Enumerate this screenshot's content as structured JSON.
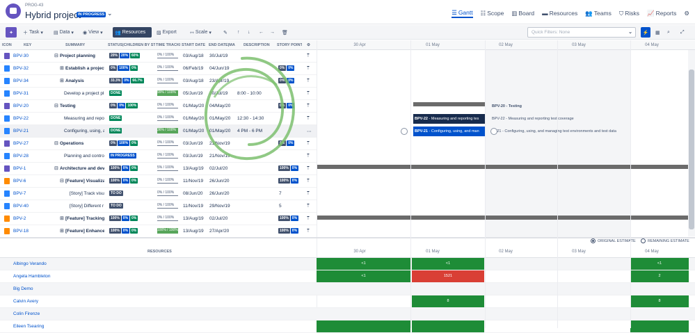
{
  "header": {
    "project_id": "PROG-43",
    "title": "Hybrid project",
    "status": "IN PROGRESS",
    "views": [
      {
        "label": "Gantt",
        "icon": "gantt-icon",
        "active": true
      },
      {
        "label": "Scope",
        "icon": "scope-icon"
      },
      {
        "label": "Board",
        "icon": "board-icon"
      },
      {
        "label": "Resources",
        "icon": "resources-icon"
      },
      {
        "label": "Teams",
        "icon": "teams-icon"
      },
      {
        "label": "Risks",
        "icon": "risks-icon"
      },
      {
        "label": "Reports",
        "icon": "reports-icon"
      }
    ]
  },
  "toolbar": {
    "task": "Task",
    "data": "Data",
    "view": "View",
    "resources": "Resources",
    "export": "Export",
    "scale": "Scale",
    "quick_filters": "Quick Filters: None"
  },
  "columns": {
    "icon": "ICON",
    "key": "KEY",
    "summary": "SUMMARY",
    "status": "STATUS|CHILDREN BY STATUS",
    "time": "TIME TRACKING",
    "start": "START DATE",
    "end": "END DATE|MANUAL",
    "desc": "DESCRIPTION",
    "sp": "STORY POINTS"
  },
  "timeline": {
    "dates": [
      "30 Apr",
      "01 May",
      "02 May",
      "03 May",
      "04 May"
    ]
  },
  "rows": [
    {
      "key": "BPV-30",
      "icon": "epic",
      "summary": "Project planning",
      "bold": true,
      "exp": "⊟",
      "ind": 0,
      "badges": [
        "20%",
        "20%",
        "60%"
      ],
      "bc": [
        "gr",
        "bl",
        "g"
      ],
      "time": "0% / 100%",
      "tg": false,
      "start": "03/Aug/18",
      "end": "30/Jul/19",
      "desc": "",
      "sp": ""
    },
    {
      "key": "BPV-32",
      "icon": "story",
      "summary": "Establish a project s",
      "bold": true,
      "exp": "⊞",
      "ind": 1,
      "badges": [
        "0%",
        "100%",
        "0%"
      ],
      "bc": [
        "gr",
        "bl",
        "g"
      ],
      "time": "0% / 100%",
      "tg": false,
      "start": "06/Feb/19",
      "end": "04/Jun/19",
      "desc": "",
      "sp": "0%|0%"
    },
    {
      "key": "BPV-34",
      "icon": "story",
      "summary": "Analysis",
      "bold": true,
      "exp": "⊞",
      "ind": 1,
      "badges": [
        "33.3%",
        "0%",
        "66.7%"
      ],
      "bc": [
        "gr",
        "bl",
        "g"
      ],
      "time": "0% / 100%",
      "tg": false,
      "start": "03/Aug/18",
      "end": "23/Apr/19",
      "desc": "",
      "sp": "0%|0%"
    },
    {
      "key": "BPV-31",
      "icon": "story",
      "summary": "Develop a project pl",
      "bold": false,
      "exp": "",
      "ind": 1,
      "badges": [
        "DONE"
      ],
      "bc": [
        "g"
      ],
      "time": "99% / 100%",
      "tg": true,
      "start": "05/Jun/19",
      "end": "30/Jul/19",
      "desc": "8:00 - 10:00",
      "sp": ""
    },
    {
      "key": "BPV-20",
      "icon": "epic",
      "summary": "Testing",
      "bold": true,
      "exp": "⊟",
      "ind": 0,
      "badges": [
        "0%",
        "0%",
        "100%"
      ],
      "bc": [
        "gr",
        "bl",
        "g"
      ],
      "time": "0% / 100%",
      "tg": false,
      "start": "01/May/20",
      "end": "04/May/20",
      "desc": "",
      "sp": "0%|0%"
    },
    {
      "key": "BPV-22",
      "icon": "story",
      "summary": "Measuring and repo",
      "bold": false,
      "exp": "",
      "ind": 1,
      "badges": [
        "DONE"
      ],
      "bc": [
        "g"
      ],
      "time": "0% / 100%",
      "tg": false,
      "start": "01/May/20",
      "end": "01/May/20",
      "desc": "12:30 - 14:30",
      "sp": ""
    },
    {
      "key": "BPV-21",
      "icon": "story",
      "summary": "Configuring, using, a",
      "bold": false,
      "exp": "",
      "ind": 1,
      "badges": [
        "DONE"
      ],
      "bc": [
        "g"
      ],
      "time": "36% / 100%",
      "tg": true,
      "start": "01/May/20",
      "end": "01/May/20",
      "desc": "4 PM - 6 PM",
      "sp": "",
      "sel": true
    },
    {
      "key": "BPV-27",
      "icon": "epic",
      "summary": "Operations",
      "bold": true,
      "exp": "⊟",
      "ind": 0,
      "badges": [
        "0%",
        "100%",
        "0%"
      ],
      "bc": [
        "gr",
        "bl",
        "g"
      ],
      "time": "0% / 100%",
      "tg": false,
      "start": "03/Jun/19",
      "end": "21/Nov/19",
      "desc": "",
      "sp": "0%|0%"
    },
    {
      "key": "BPV-28",
      "icon": "story",
      "summary": "Planning and contro",
      "bold": false,
      "exp": "",
      "ind": 1,
      "badges": [
        "IN PROGRESS"
      ],
      "bc": [
        "bl"
      ],
      "time": "0% / 100%",
      "tg": false,
      "start": "03/Jun/19",
      "end": "21/Nov/19",
      "desc": "",
      "sp": ""
    },
    {
      "key": "BPV-1",
      "icon": "epic",
      "summary": "Architecture and deve",
      "bold": true,
      "exp": "⊟",
      "ind": 0,
      "badges": [
        "100%",
        "0%",
        "0%"
      ],
      "bc": [
        "gr",
        "bl",
        "g"
      ],
      "time": "5% / 100%",
      "tg": false,
      "start": "13/Aug/19",
      "end": "02/Jul/20",
      "desc": "",
      "sp": "100%|0%"
    },
    {
      "key": "BPV-6",
      "icon": "feature",
      "summary": "[Feature] Visualizat",
      "bold": true,
      "exp": "⊟",
      "ind": 1,
      "badges": [
        "100%",
        "0%",
        "0%"
      ],
      "bc": [
        "gr",
        "bl",
        "g"
      ],
      "time": "0% / 100%",
      "tg": false,
      "start": "11/Nov/19",
      "end": "26/Jun/20",
      "desc": "",
      "sp": "100%|0%"
    },
    {
      "key": "BPV-7",
      "icon": "story",
      "summary": "[Story] Track visu",
      "bold": false,
      "exp": "",
      "ind": 2,
      "badges": [
        "TO DO"
      ],
      "bc": [
        "gr"
      ],
      "time": "0% / 100%",
      "tg": false,
      "start": "08/Jun/20",
      "end": "26/Jun/20",
      "desc": "",
      "sp": "7"
    },
    {
      "key": "BPV-40",
      "icon": "story",
      "summary": "[Story] Different r",
      "bold": false,
      "exp": "",
      "ind": 2,
      "badges": [
        "TO DO"
      ],
      "bc": [
        "gr"
      ],
      "time": "0% / 100%",
      "tg": false,
      "start": "11/Nov/19",
      "end": "29/Nov/19",
      "desc": "",
      "sp": "5"
    },
    {
      "key": "BPV-2",
      "icon": "feature",
      "summary": "[Feature] Tracking a",
      "bold": true,
      "exp": "⊞",
      "ind": 1,
      "badges": [
        "100%",
        "0%",
        "0%"
      ],
      "bc": [
        "gr",
        "bl",
        "g"
      ],
      "time": "0% / 100%",
      "tg": false,
      "start": "13/Aug/19",
      "end": "02/Jul/20",
      "desc": "",
      "sp": "100%|0%"
    },
    {
      "key": "BPV-18",
      "icon": "feature",
      "summary": "[Feature] Enhanced",
      "bold": true,
      "exp": "⊞",
      "ind": 1,
      "badges": [
        "100%",
        "0%",
        "0%"
      ],
      "bc": [
        "gr",
        "bl",
        "g"
      ],
      "time": "100% / 100%",
      "tg": true,
      "start": "13/Aug/19",
      "end": "27/Apr/20",
      "desc": "",
      "sp": "100%|0%"
    }
  ],
  "gantt": {
    "testing_label": "BPV-20 - Testing",
    "bpv22_key": "BPV-22",
    "bpv22_text": " - Measuring and reporting tes",
    "bpv22_label": "BPV-22 - Measuring and reporting test coverage",
    "bpv21_key": "BPV-21",
    "bpv21_text": " - Configuring, using, and man",
    "bpv21_label": "/-21 - Configuring, using, and managing test environments and test data"
  },
  "estimates": {
    "original": "ORIGINAL ESTIMATE",
    "remaining": "REMAINING ESTIMATE"
  },
  "resources": {
    "header": "RESOURCES",
    "people": [
      {
        "name": "Albingo Verando",
        "cells": [
          {
            "c": 0,
            "v": "<1",
            "t": "gn"
          },
          {
            "c": 1,
            "v": "<1",
            "t": "gn"
          },
          {
            "c": 4,
            "v": "<1",
            "t": "gn"
          }
        ]
      },
      {
        "name": "Angela Hambleton",
        "cells": [
          {
            "c": 0,
            "v": "<1",
            "t": "gn"
          },
          {
            "c": 1,
            "v": "1521",
            "t": "rd"
          },
          {
            "c": 4,
            "v": "2",
            "t": "gn"
          }
        ]
      },
      {
        "name": "Big Demo",
        "cells": []
      },
      {
        "name": "Calvin Avery",
        "cells": [
          {
            "c": 1,
            "v": "8",
            "t": "gn"
          },
          {
            "c": 4,
            "v": "8",
            "t": "gn"
          }
        ]
      },
      {
        "name": "Colin Firenze",
        "cells": []
      },
      {
        "name": "Eileen Tsearing",
        "cells": [
          {
            "c": 0,
            "v": "",
            "t": "gn"
          },
          {
            "c": 1,
            "v": "",
            "t": "gn"
          },
          {
            "c": 4,
            "v": "",
            "t": "gn"
          }
        ]
      }
    ]
  }
}
